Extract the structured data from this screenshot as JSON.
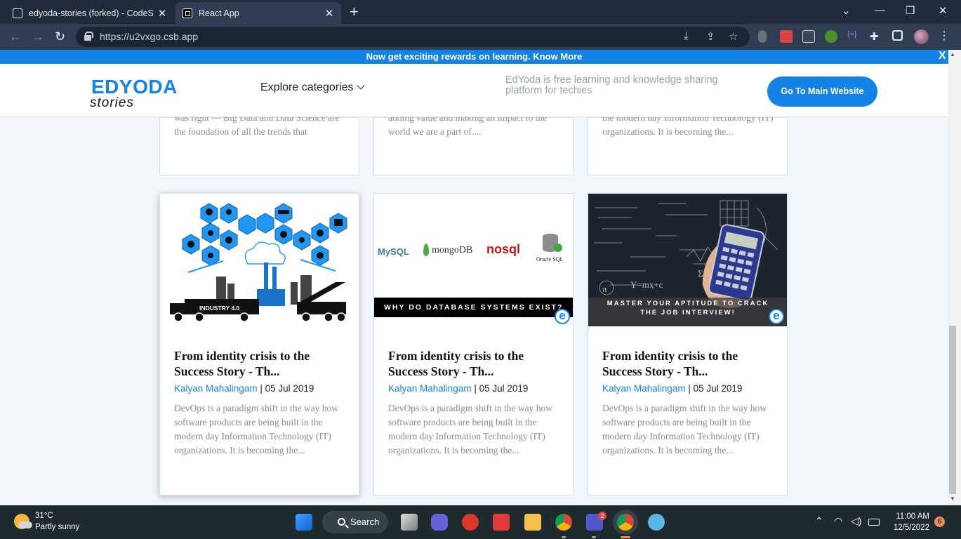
{
  "browser": {
    "tabs": [
      {
        "title": "edyoda-stories (forked) - CodeSandbox",
        "active": false
      },
      {
        "title": "React App",
        "active": true
      }
    ],
    "url": "https://u2vxgo.csb.app"
  },
  "promo": {
    "text": "Now get exciting rewards on learning. Know More",
    "close": "X"
  },
  "header": {
    "logo_main": "EDYODA",
    "logo_sub": "stories",
    "explore": "Explore categories",
    "tagline": "EdYoda is free learning and knowledge sharing platform for techies",
    "cta": "Go To Main Website"
  },
  "top_cards": [
    {
      "excerpt": "was right — Big Data and Data Science are the foundation of all the trends that"
    },
    {
      "excerpt": "adding value and making an impact to the world we are a part of...."
    },
    {
      "excerpt": "the modern day Information Technology (IT) organizations. It is becoming the..."
    }
  ],
  "cards": [
    {
      "title": "From identity crisis to the Success Story - Th...",
      "author": "Kalyan Mahalingam",
      "separator": " | ",
      "date": "05 Jul 2019",
      "desc": "DevOps is a paradigm shift in the way how software products are being built in the modern day Information Technology (IT) organizations. It is becoming the...",
      "thumb_caption": "INDUSTRY 4.0"
    },
    {
      "title": "From identity crisis to the Success Story - Th...",
      "author": "Kalyan Mahalingam",
      "separator": " | ",
      "date": "05 Jul 2019",
      "desc": "DevOps is a paradigm shift in the way how software products are being built in the modern day Information Technology (IT) organizations. It is becoming the...",
      "thumb_caption": "WHY DO DATABASE SYSTEMS EXIST?",
      "thumb_logos": [
        "MySQL",
        "mongoDB",
        "nosql",
        "Oracle SQL"
      ]
    },
    {
      "title": "From identity crisis to the Success Story - Th...",
      "author": "Kalyan Mahalingam",
      "separator": " | ",
      "date": "05 Jul 2019",
      "desc": "DevOps is a paradigm shift in the way how software products are being built in the modern day Information Technology (IT) organizations. It is becoming the...",
      "thumb_caption": "MASTER YOUR APTITUDE TO CRACK THE JOB INTERVIEW!"
    }
  ],
  "badge_letter": "e",
  "taskbar": {
    "temp": "31°C",
    "weather": "Partly sunny",
    "search": "Search",
    "time": "11:00 AM",
    "date": "12/5/2022",
    "notifications": "6",
    "teams_badge": "2"
  },
  "colors": {
    "brand_blue": "#1483e8",
    "page_bg": "#f1f6fb",
    "chrome_bg": "#202c3c"
  }
}
